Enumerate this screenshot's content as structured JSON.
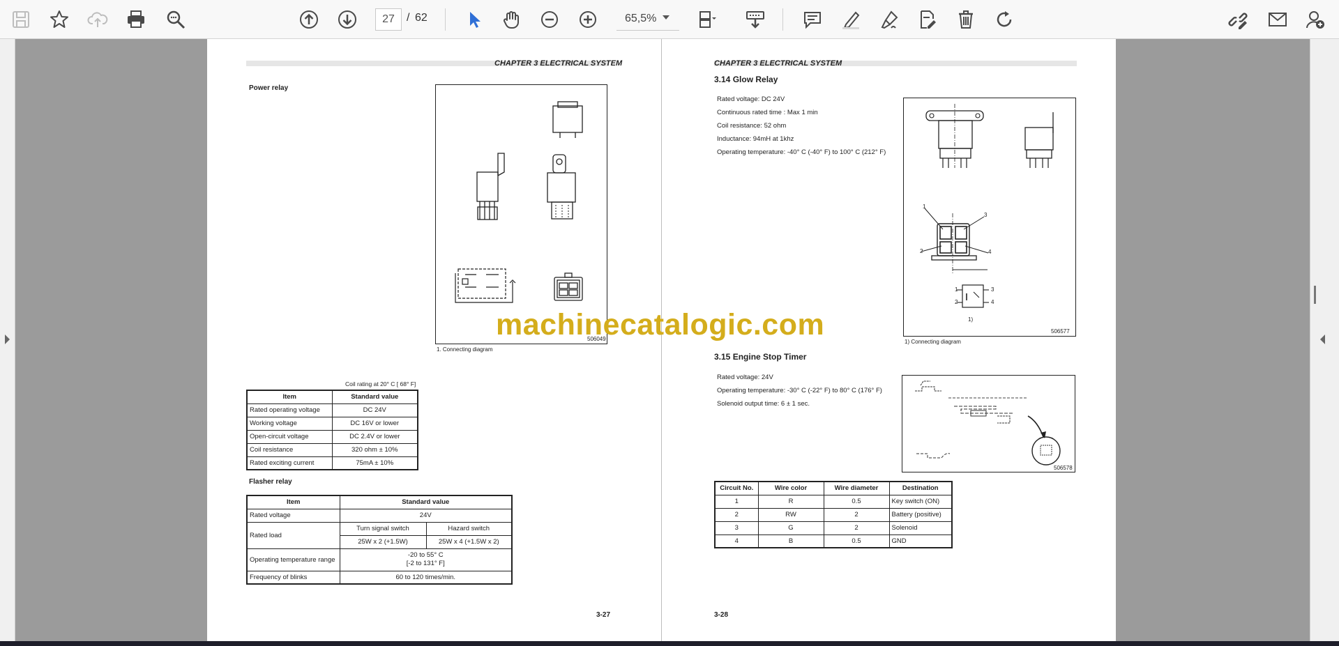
{
  "toolbar": {
    "current_page": "27",
    "page_separator": "/",
    "total_pages": "62",
    "zoom": "65,5%"
  },
  "left_page": {
    "chapter": "CHAPTER 3 ELECTRICAL SYSTEM",
    "power_relay_title": "Power relay",
    "figure_id": "506049",
    "figure_caption": "1. Connecting diagram",
    "coil_note": "Coil rating at 20° C [ 68° F]",
    "coil_table": {
      "headers": [
        "Item",
        "Standard value"
      ],
      "rows": [
        [
          "Rated operating voltage",
          "DC 24V"
        ],
        [
          "Working voltage",
          "DC 16V or lower"
        ],
        [
          "Open-circuit voltage",
          "DC 2.4V or lower"
        ],
        [
          "Coil resistance",
          "320 ohm ± 10%"
        ],
        [
          "Rated exciting current",
          "75mA ± 10%"
        ]
      ]
    },
    "flasher_title": "Flasher relay",
    "flasher_table": {
      "headers": [
        "Item",
        "Standard value"
      ],
      "rated_voltage_label": "Rated voltage",
      "rated_voltage_value": "24V",
      "rated_load_label": "Rated load",
      "turn_signal_label": "Turn signal switch",
      "hazard_label": "Hazard switch",
      "turn_signal_value": "25W x 2 (+1.5W)",
      "hazard_value": "25W x 4 (+1.5W x 2)",
      "op_temp_label": "Operating temperature range",
      "op_temp_line1": "-20 to 55° C",
      "op_temp_line2": "[-2 to 131° F]",
      "blinks_label": "Frequency of blinks",
      "blinks_value": "60 to 120 times/min."
    },
    "page_number": "3-27"
  },
  "right_page": {
    "chapter": "CHAPTER 3 ELECTRICAL SYSTEM",
    "glow_section": "3.14    Glow Relay",
    "glow_specs": [
      "Rated voltage: DC 24V",
      "Continuous rated time : Max 1 min",
      "Coil resistance: 52 ohm",
      "Inductance: 94mH at 1khz",
      "Operating temperature: -40° C (-40° F) to 100° C (212° F)"
    ],
    "glow_figure_id": "506577",
    "glow_figure_caption": "1) Connecting diagram",
    "glow_figure_label": "1)",
    "pin_labels": [
      "1",
      "2",
      "3",
      "4"
    ],
    "timer_section": "3.15    Engine Stop Timer",
    "timer_specs": [
      "Rated voltage: 24V",
      "Operating temperature: -30° C (-22° F) to 80° C (176° F)",
      "Solenoid output time: 6  ± 1 sec."
    ],
    "timer_figure_id": "506578",
    "wire_table": {
      "headers": [
        "Circuit No.",
        "Wire color",
        "Wire diameter",
        "Destination"
      ],
      "rows": [
        [
          "1",
          "R",
          "0.5",
          "Key switch (ON)"
        ],
        [
          "2",
          "RW",
          "2",
          "Battery (positive)"
        ],
        [
          "3",
          "G",
          "2",
          "Solenoid"
        ],
        [
          "4",
          "B",
          "0.5",
          "GND"
        ]
      ]
    },
    "page_number": "3-28"
  },
  "watermark": "machinecatalogic.com",
  "colors": {
    "watermark": "#d4ad1c",
    "viewer_bg": "#9b9b9b",
    "icon_blue": "#2f6fd6",
    "icon_gray": "#4a4a4a"
  }
}
